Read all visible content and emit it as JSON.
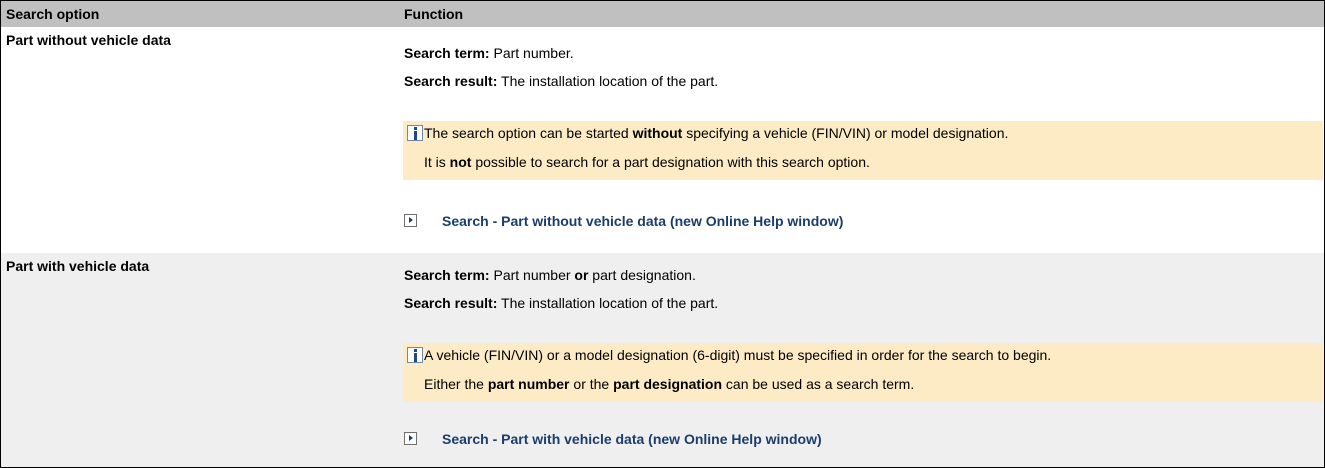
{
  "table": {
    "headers": [
      "Search option",
      "Function"
    ],
    "rows": [
      {
        "option": "Part without vehicle data",
        "term_label": "Search term:",
        "term_value": " Part number.",
        "result_label": "Search result:",
        "result_value": " The installation location of the part.",
        "note_line1_a": "The search option can be started ",
        "note_line1_b": "without",
        "note_line1_c": " specifying a vehicle (FIN/VIN) or model designation.",
        "note_line2_a": "It is ",
        "note_line2_b": "not",
        "note_line2_c": " possible to search for a part designation with this search option.",
        "link": "Search - Part without vehicle data (new Online Help window)"
      },
      {
        "option": "Part with vehicle data",
        "term_label": "Search term:",
        "term_value_a": " Part number ",
        "term_value_b": "or",
        "term_value_c": " part designation.",
        "result_label": "Search result:",
        "result_value": " The installation location of the part.",
        "note_line1": "A vehicle (FIN/VIN) or a model designation (6-digit) must be specified in order for the search to begin.",
        "note_line2_a": "Either the ",
        "note_line2_b": "part number",
        "note_line2_c": " or the ",
        "note_line2_d": "part designation",
        "note_line2_e": " can be used as a search term.",
        "link": "Search - Part with vehicle data (new Online Help window)"
      }
    ]
  },
  "icons": {
    "info": "info-icon",
    "link_arrow": "play-arrow-icon"
  },
  "colors": {
    "header_bg": "#c0c0c0",
    "row2_bg": "#efefef",
    "note_bg": "#fcebc5",
    "link": "#1a3d6b"
  }
}
